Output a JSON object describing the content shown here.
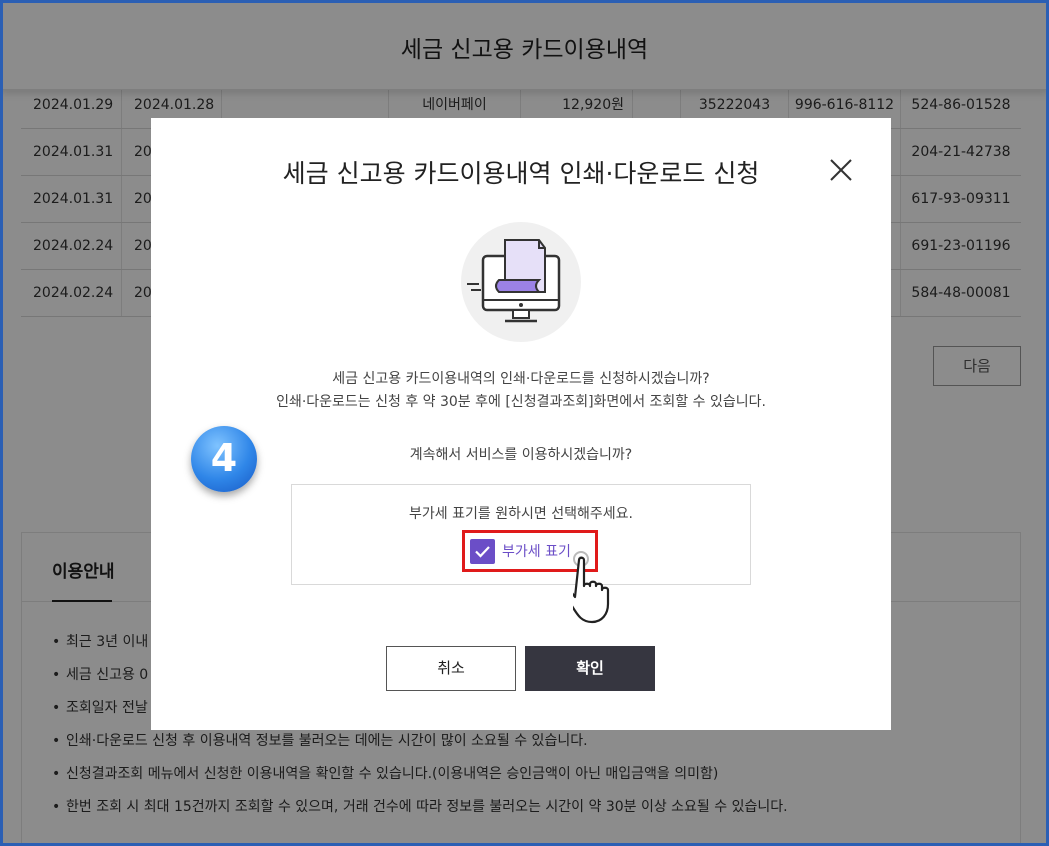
{
  "header": {
    "title": "세금 신고용 카드이용내역"
  },
  "table": {
    "rows": [
      [
        "2024.01.29",
        "2024.01.28",
        "",
        "네이버페이",
        "12,920원",
        "",
        "35222043",
        "996-616-8112",
        "524-86-01528"
      ],
      [
        "2024.01.31",
        "20",
        "",
        "",
        "",
        "",
        "",
        "",
        "204-21-42738"
      ],
      [
        "2024.01.31",
        "20",
        "",
        "",
        "",
        "",
        "",
        "",
        "617-93-09311"
      ],
      [
        "2024.02.24",
        "20",
        "",
        "",
        "",
        "",
        "",
        "",
        "691-23-01196"
      ],
      [
        "2024.02.24",
        "20",
        "",
        "",
        "",
        "",
        "",
        "",
        "584-48-00081"
      ]
    ]
  },
  "pagination": {
    "next_label": "다음"
  },
  "guide": {
    "title": "이용안내",
    "items": [
      "최근 3년 이내",
      "세금 신고용 0",
      "조회일자 전날",
      "인쇄·다운로드 신청 후 이용내역 정보를 불러오는 데에는 시간이 많이 소요될 수 있습니다.",
      "신청결과조회 메뉴에서 신청한 이용내역을 확인할 수 있습니다.(이용내역은 승인금액이 아닌 매입금액을 의미함)",
      "한번 조회 시 최대 15건까지 조회할 수 있으며, 거래 건수에 따라 정보를 불러오는 시간이 약 30분 이상 소요될 수 있습니다."
    ]
  },
  "modal": {
    "title": "세금 신고용 카드이용내역 인쇄·다운로드 신청",
    "desc_line1": "세금 신고용 카드이용내역의 인쇄·다운로드를 신청하시겠습니까?",
    "desc_line2": "인쇄·다운로드는 신청 후 약 30분 후에 [신청결과조회]화면에서 조회할 수 있습니다.",
    "confirm_question": "계속해서 서비스를 이용하시겠습니까?",
    "vat_prompt": "부가세 표기를 원하시면 선택해주세요.",
    "vat_checkbox_label": "부가세 표기",
    "vat_checked": true,
    "cancel_label": "취소",
    "ok_label": "확인"
  },
  "step_badge": {
    "number": "4"
  },
  "colors": {
    "accent": "#6b4ec7",
    "highlight": "#e01a1a",
    "badge": "#2f86e8",
    "ok_button": "#363640",
    "frame": "#2b5fb4"
  }
}
